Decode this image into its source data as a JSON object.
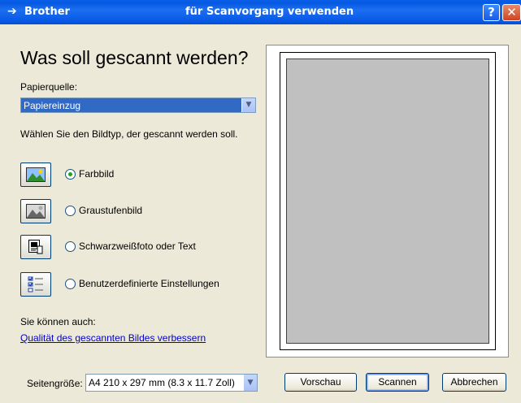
{
  "window": {
    "app_name": "Brother",
    "title": "für Scanvorgang verwenden",
    "help_label": "?",
    "close_label": "✕"
  },
  "heading": "Was soll gescannt werden?",
  "source": {
    "label": "Papierquelle:",
    "value": "Papiereinzug"
  },
  "type_prompt": "Wählen Sie den Bildtyp, der gescannt werden soll.",
  "image_types": [
    {
      "label": "Farbbild",
      "icon": "color-picture-icon",
      "checked": true
    },
    {
      "label": "Graustufenbild",
      "icon": "grayscale-picture-icon",
      "checked": false
    },
    {
      "label": "Schwarzweißfoto oder Text",
      "icon": "bw-text-icon",
      "checked": false
    },
    {
      "label": "Benutzerdefinierte Einstellungen",
      "icon": "custom-settings-icon",
      "checked": false
    }
  ],
  "also": {
    "label": "Sie können auch:",
    "link": "Qualität des gescannten Bildes verbessern"
  },
  "page_size": {
    "label": "Seitengröße:",
    "value": "A4 210 x 297 mm (8.3 x 11.7 Zoll)"
  },
  "buttons": {
    "preview": "Vorschau",
    "scan": "Scannen",
    "cancel": "Abbrechen"
  },
  "colors": {
    "titlebar": "#0a5fe9",
    "selection": "#316ac5",
    "link": "#0000cc",
    "dialog_bg": "#ece9d8",
    "preview_page": "#c0c0c0"
  }
}
